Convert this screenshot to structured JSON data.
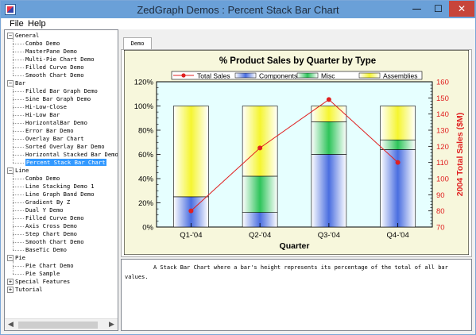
{
  "window": {
    "title": "ZedGraph Demos : Percent Stack Bar Chart",
    "minimize_glyph": "—",
    "maximize_glyph": "☐",
    "close_glyph": "✕"
  },
  "menu": {
    "file": "File",
    "help": "Help"
  },
  "tree": [
    {
      "type": "group",
      "label": "General",
      "expanded": true
    },
    {
      "type": "item",
      "label": "Combo Demo"
    },
    {
      "type": "item",
      "label": "MasterPane Demo"
    },
    {
      "type": "item",
      "label": "Multi-Pie Chart Demo"
    },
    {
      "type": "item",
      "label": "Filled Curve Demo"
    },
    {
      "type": "item",
      "label": "Smooth Chart Demo"
    },
    {
      "type": "group",
      "label": "Bar",
      "expanded": true
    },
    {
      "type": "item",
      "label": "Filled Bar Graph Demo"
    },
    {
      "type": "item",
      "label": "Sine Bar Graph Demo"
    },
    {
      "type": "item",
      "label": "Hi-Low-Close"
    },
    {
      "type": "item",
      "label": "Hi-Low Bar"
    },
    {
      "type": "item",
      "label": "HorizontalBar Demo"
    },
    {
      "type": "item",
      "label": "Error Bar Demo"
    },
    {
      "type": "item",
      "label": "Overlay Bar Chart"
    },
    {
      "type": "item",
      "label": "Sorted Overlay Bar Demo"
    },
    {
      "type": "item",
      "label": "Horizontal Stacked Bar Demo"
    },
    {
      "type": "item",
      "label": "Percent Stack Bar Chart",
      "selected": true
    },
    {
      "type": "group",
      "label": "Line",
      "expanded": true
    },
    {
      "type": "item",
      "label": "Combo Demo"
    },
    {
      "type": "item",
      "label": "Line Stacking Demo 1"
    },
    {
      "type": "item",
      "label": "Line Graph Band Demo"
    },
    {
      "type": "item",
      "label": "Gradient By Z"
    },
    {
      "type": "item",
      "label": "Dual Y Demo"
    },
    {
      "type": "item",
      "label": "Filled Curve Demo"
    },
    {
      "type": "item",
      "label": "Axis Cross Demo"
    },
    {
      "type": "item",
      "label": "Step Chart Demo"
    },
    {
      "type": "item",
      "label": "Smooth Chart Demo"
    },
    {
      "type": "item",
      "label": "BaseTic Demo"
    },
    {
      "type": "group",
      "label": "Pie",
      "expanded": true
    },
    {
      "type": "item",
      "label": "Pie Chart Demo"
    },
    {
      "type": "item",
      "label": "Pie Sample"
    },
    {
      "type": "group",
      "label": "Special Features",
      "expanded": false
    },
    {
      "type": "group",
      "label": "Tutorial",
      "expanded": false
    }
  ],
  "tab": {
    "label": "Demo"
  },
  "description": "A Stack Bar Chart where a bar's height represents its percentage of the total of all bar values.",
  "colors": {
    "components": "#4a6ee0",
    "misc": "#2ec45a",
    "assemblies": "#f5f530",
    "total_sales": "#e02020",
    "plot_bg": "#e6ffff",
    "frame_bg": "#f7f7dc"
  },
  "chart_data": {
    "type": "bar",
    "title": "% Product Sales by Quarter by Type",
    "xlabel": "Quarter",
    "ylabel": "",
    "y2label": "2004 Total Sales ($M)",
    "categories": [
      "Q1-'04",
      "Q2-'04",
      "Q3-'04",
      "Q4-'04"
    ],
    "ylim": [
      0,
      120
    ],
    "y_ticks": [
      "0%",
      "20%",
      "40%",
      "60%",
      "80%",
      "100%",
      "120%"
    ],
    "y2lim": [
      70,
      160
    ],
    "y2_ticks": [
      "70",
      "80",
      "90",
      "100",
      "110",
      "120",
      "130",
      "140",
      "150",
      "160"
    ],
    "stacked_percent": true,
    "series": [
      {
        "name": "Components",
        "values": [
          25,
          12,
          60,
          64
        ]
      },
      {
        "name": "Misc",
        "values": [
          0,
          30,
          27,
          8
        ]
      },
      {
        "name": "Assemblies",
        "values": [
          75,
          58,
          13,
          28
        ]
      }
    ],
    "line_series": {
      "name": "Total Sales",
      "axis": "y2",
      "values": [
        80,
        119,
        149,
        110
      ]
    },
    "legend_position": "top",
    "grid": false
  }
}
